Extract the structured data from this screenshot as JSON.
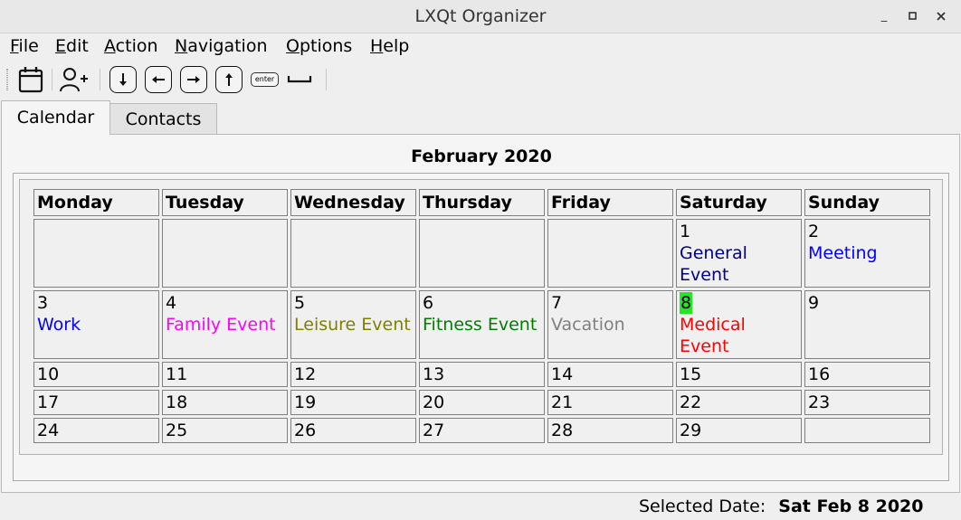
{
  "window": {
    "title": "LXQt Organizer",
    "minimize_glyph": "_",
    "maximize_glyph": "□",
    "close_glyph": "✕"
  },
  "menu": [
    "File",
    "Edit",
    "Action",
    "Navigation",
    "Options",
    "Help"
  ],
  "toolbar": {
    "icons": [
      "calendar-icon",
      "add-contact-icon",
      "arrow-down-key-icon",
      "arrow-left-key-icon",
      "arrow-right-key-icon",
      "arrow-up-key-icon",
      "enter-key-icon",
      "space-key-icon"
    ],
    "enter_label": "enter"
  },
  "tabs": [
    {
      "label": "Calendar",
      "active": true
    },
    {
      "label": "Contacts",
      "active": false
    }
  ],
  "calendar": {
    "month_title": "February 2020",
    "weekdays": [
      "Monday",
      "Tuesday",
      "Wednesday",
      "Thursday",
      "Friday",
      "Saturday",
      "Sunday"
    ],
    "weeks": [
      [
        {
          "day": ""
        },
        {
          "day": ""
        },
        {
          "day": ""
        },
        {
          "day": ""
        },
        {
          "day": ""
        },
        {
          "day": "1",
          "event": "General Event",
          "color": "#000080"
        },
        {
          "day": "2",
          "event": "Meeting",
          "color": "#0000ff"
        }
      ],
      [
        {
          "day": "3",
          "event": "Work",
          "color": "#0000ff"
        },
        {
          "day": "4",
          "event": "Family Event",
          "color": "#ff00ff"
        },
        {
          "day": "5",
          "event": "Leisure Event",
          "color": "#808000"
        },
        {
          "day": "6",
          "event": "Fitness Event",
          "color": "#008000"
        },
        {
          "day": "7",
          "event": "Vacation",
          "color": "#808080"
        },
        {
          "day": "8",
          "event": "Medical Event",
          "color": "#ff0000",
          "selected": true
        },
        {
          "day": "9"
        }
      ],
      [
        {
          "day": "10"
        },
        {
          "day": "11"
        },
        {
          "day": "12"
        },
        {
          "day": "13"
        },
        {
          "day": "14"
        },
        {
          "day": "15"
        },
        {
          "day": "16"
        }
      ],
      [
        {
          "day": "17"
        },
        {
          "day": "18"
        },
        {
          "day": "19"
        },
        {
          "day": "20"
        },
        {
          "day": "21"
        },
        {
          "day": "22"
        },
        {
          "day": "23"
        }
      ],
      [
        {
          "day": "24"
        },
        {
          "day": "25"
        },
        {
          "day": "26"
        },
        {
          "day": "27"
        },
        {
          "day": "28"
        },
        {
          "day": "29"
        },
        {
          "day": ""
        }
      ]
    ],
    "selected_highlight_color": "#22e822"
  },
  "status": {
    "label": "Selected Date:",
    "value": "Sat Feb 8 2020"
  }
}
